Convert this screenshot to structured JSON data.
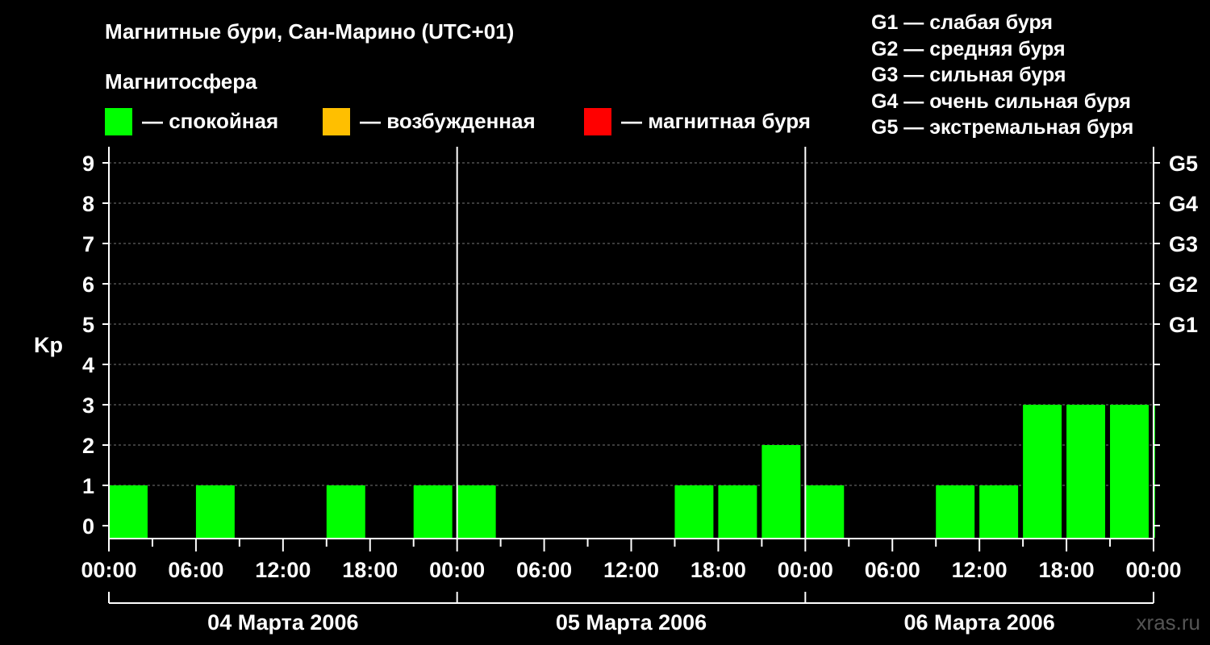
{
  "header": {
    "title": "Магнитные бури, Сан-Марино (UTC+01)",
    "subtitle": "Магнитосфера"
  },
  "legend": {
    "items": [
      {
        "label": "— спокойная",
        "color": "#00ff00"
      },
      {
        "label": "— возбужденная",
        "color": "#ffbf00"
      },
      {
        "label": "— магнитная буря",
        "color": "#ff0000"
      }
    ]
  },
  "storm_levels": [
    "G1 — слабая буря",
    "G2 — средняя буря",
    "G3 — сильная буря",
    "G4 — очень сильная буря",
    "G5 — экстремальная буря"
  ],
  "watermark": "xras.ru",
  "chart_data": {
    "type": "bar",
    "ylabel": "Kp",
    "ylim": [
      0,
      9
    ],
    "yticks": [
      "0",
      "1",
      "2",
      "3",
      "4",
      "5",
      "6",
      "7",
      "8",
      "9"
    ],
    "g_scale": [
      {
        "kp": 5,
        "label": "G1"
      },
      {
        "kp": 6,
        "label": "G2"
      },
      {
        "kp": 7,
        "label": "G3"
      },
      {
        "kp": 8,
        "label": "G4"
      },
      {
        "kp": 9,
        "label": "G5"
      }
    ],
    "x_tick_labels": [
      "00:00",
      "06:00",
      "12:00",
      "18:00",
      "00:00",
      "06:00",
      "12:00",
      "18:00",
      "00:00",
      "06:00",
      "12:00",
      "18:00",
      "00:00"
    ],
    "days": [
      "04 Марта 2006",
      "05 Марта 2006",
      "06 Марта 2006"
    ],
    "interval_hours": 3,
    "values": [
      1,
      0,
      1,
      0,
      0,
      1,
      0,
      1,
      1,
      0,
      0,
      0,
      0,
      1,
      1,
      2,
      1,
      0,
      0,
      1,
      1,
      3,
      3,
      3,
      3
    ],
    "bar_color": "#00ff00",
    "grid": true
  }
}
